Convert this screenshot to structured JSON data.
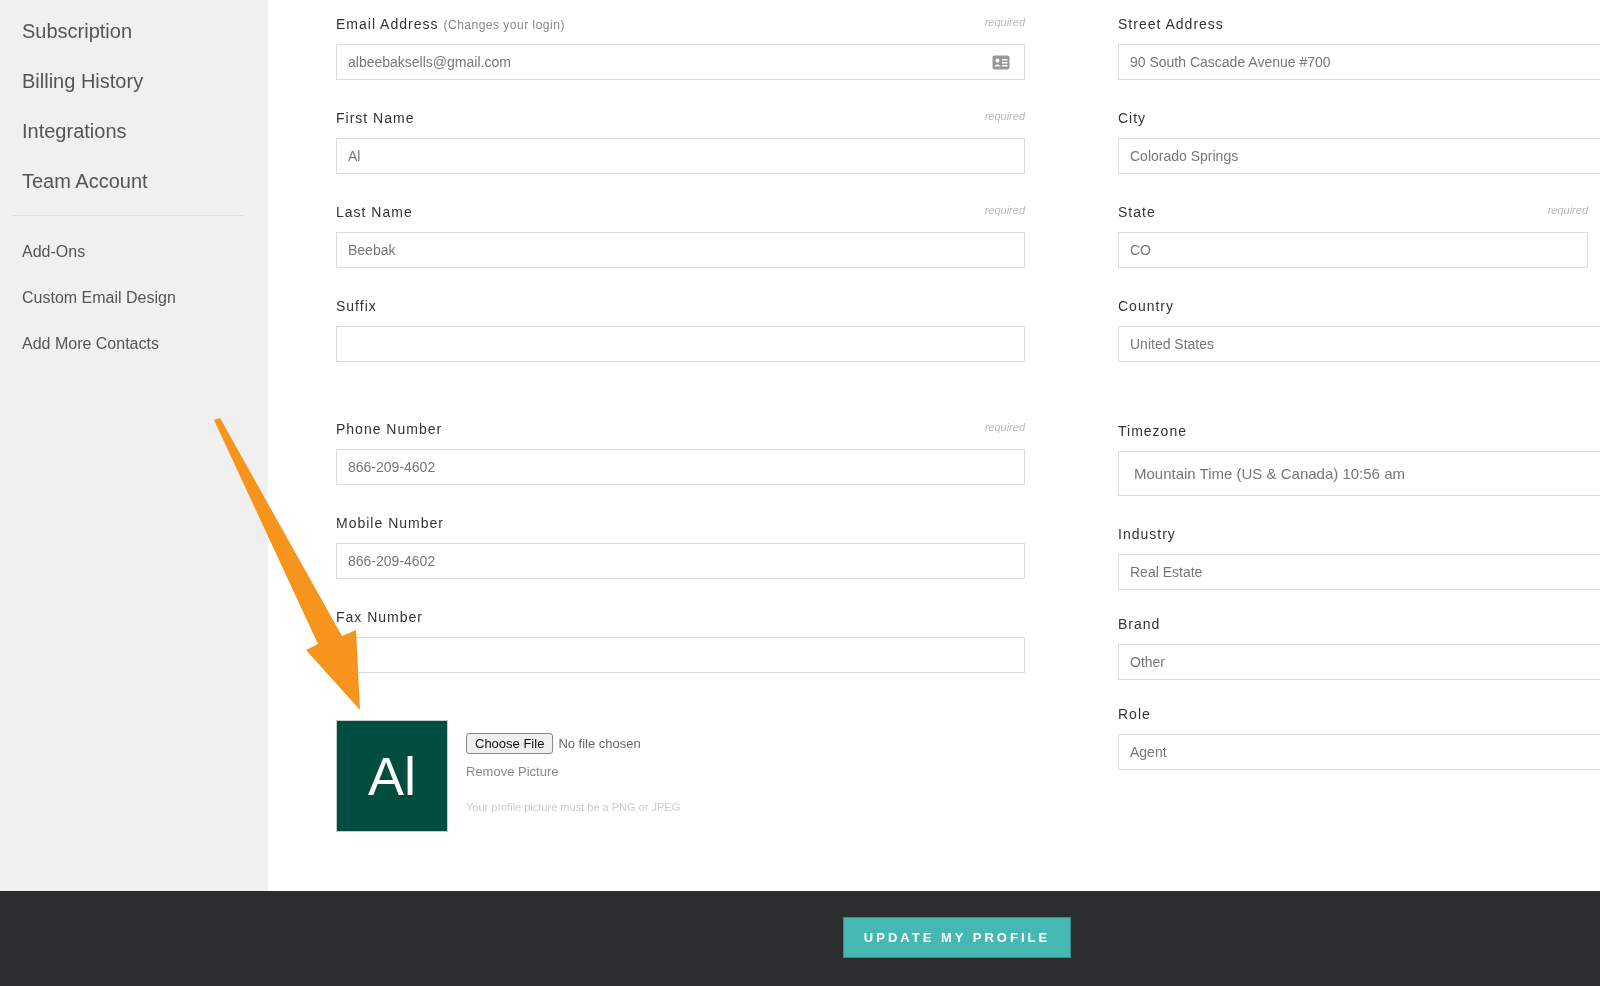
{
  "sidebar": {
    "primary_items": [
      {
        "label": "Subscription"
      },
      {
        "label": "Billing History"
      },
      {
        "label": "Integrations"
      },
      {
        "label": "Team Account"
      }
    ],
    "secondary_items": [
      {
        "label": "Add-Ons"
      },
      {
        "label": "Custom Email Design"
      },
      {
        "label": "Add More Contacts"
      }
    ]
  },
  "left_fields": [
    {
      "label": "Email Address",
      "hint": "(Changes your login)",
      "required_note": "required",
      "value": "albeebaksells@gmail.com",
      "kind": "contact"
    },
    {
      "label": "First Name",
      "required_note": "required",
      "value": "Al",
      "kind": "text"
    },
    {
      "label": "Last Name",
      "required_note": "required",
      "value": "Beebak",
      "kind": "text"
    },
    {
      "label": "Suffix",
      "kind": "text"
    },
    {
      "label": "Phone Number",
      "required_note": "required",
      "value": "866-209-4602",
      "kind": "text"
    },
    {
      "label": "Mobile Number",
      "value": "866-209-4602",
      "kind": "text"
    },
    {
      "label": "Fax Number",
      "kind": "text"
    }
  ],
  "right_fields": [
    {
      "label": "Street Address",
      "value": "90 South Cascade Avenue #700",
      "kind": "text"
    },
    {
      "label": "City",
      "value": "Colorado Springs",
      "kind": "text"
    },
    {
      "label": "State",
      "required_note": "required",
      "value": "CO",
      "kind": "short"
    },
    {
      "label": "Country",
      "value": "United States",
      "kind": "text"
    },
    {
      "label": "Timezone",
      "value": "Mountain Time (US & Canada) 10:56 am",
      "kind": "tall"
    },
    {
      "label": "Industry",
      "value": "Real Estate",
      "kind": "text"
    },
    {
      "label": "Brand",
      "value": "Other",
      "kind": "text"
    },
    {
      "label": "Role",
      "value": "Agent",
      "kind": "text"
    }
  ],
  "picture": {
    "initials": "Al",
    "choose_button": "Choose File",
    "file_status": "No file chosen",
    "remove_link": "Remove Picture",
    "note": "Your profile picture must be a PNG or JPEG"
  },
  "footer": {
    "submit_button": "UPDATE MY PROFILE"
  }
}
